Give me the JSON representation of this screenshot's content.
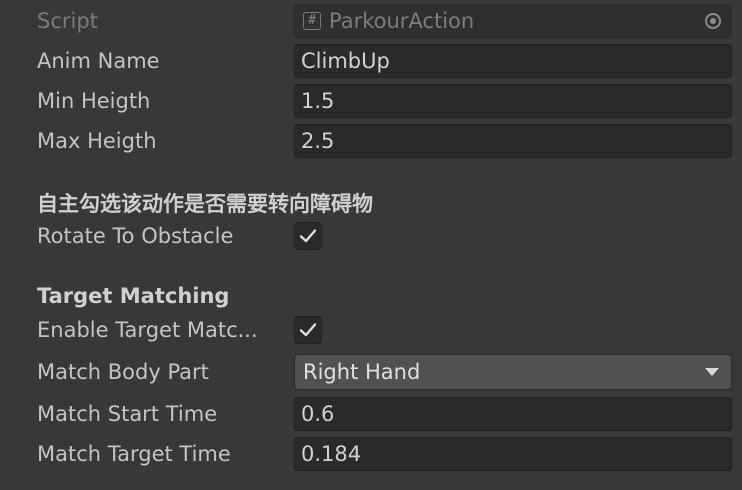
{
  "fields": {
    "script": {
      "label": "Script",
      "value": "ParkourAction"
    },
    "anim_name": {
      "label": "Anim Name",
      "value": "ClimbUp"
    },
    "min_height": {
      "label": "Min Heigth",
      "value": "1.5"
    },
    "max_height": {
      "label": "Max Heigth",
      "value": "2.5"
    }
  },
  "rotate_section": {
    "header": "自主勾选该动作是否需要转向障碍物",
    "rotate_to_obstacle": {
      "label": "Rotate To Obstacle",
      "checked": true
    }
  },
  "target_matching": {
    "header": "Target Matching",
    "enable": {
      "label": "Enable Target Matc...",
      "checked": true
    },
    "match_body_part": {
      "label": "Match Body Part",
      "value": "Right Hand"
    },
    "match_start_time": {
      "label": "Match Start Time",
      "value": "0.6"
    },
    "match_target_time": {
      "label": "Match Target Time",
      "value": "0.184"
    }
  },
  "icons": {
    "script_icon": "hash-script-icon",
    "object_picker": "target-circle-icon",
    "checkmark": "checkmark-icon",
    "dropdown": "chevron-down-icon"
  }
}
